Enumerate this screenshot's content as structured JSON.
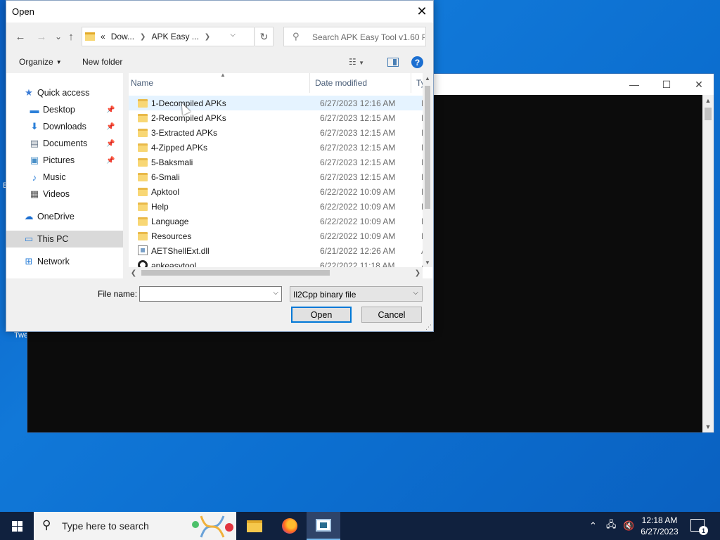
{
  "desktop": {
    "frag_letter": "E",
    "frag_text": "Twe"
  },
  "console": {
    "minimize": "—",
    "maximize": "☐",
    "close": "✕"
  },
  "dialog": {
    "title": "Open",
    "close": "✕",
    "nav": {
      "back": "←",
      "forward": "→",
      "recent": "⌄",
      "up": "↑",
      "breadcrumb": [
        "Dow...",
        "APK Easy ..."
      ],
      "crumb_prefix": "«",
      "refresh": "↻",
      "search_placeholder": "Search APK Easy Tool v1.60 P..."
    },
    "toolbar": {
      "organize": "Organize",
      "new_folder": "New folder",
      "help": "?"
    },
    "sidebar": [
      {
        "label": "Quick access",
        "icon": "star-icon",
        "glyph": "★",
        "color": "#3a7bd5"
      },
      {
        "label": "Desktop",
        "icon": "desktop-icon",
        "glyph": "▬",
        "color": "#2b7fd8",
        "pinned": true
      },
      {
        "label": "Downloads",
        "icon": "downloads-icon",
        "glyph": "⬇",
        "color": "#2b7fd8",
        "pinned": true
      },
      {
        "label": "Documents",
        "icon": "documents-icon",
        "glyph": "▤",
        "color": "#6b7b8c",
        "pinned": true
      },
      {
        "label": "Pictures",
        "icon": "pictures-icon",
        "glyph": "▣",
        "color": "#4a90c8",
        "pinned": true
      },
      {
        "label": "Music",
        "icon": "music-icon",
        "glyph": "♪",
        "color": "#2b7fd8"
      },
      {
        "label": "Videos",
        "icon": "videos-icon",
        "glyph": "▦",
        "color": "#555"
      },
      {
        "label": "OneDrive",
        "icon": "onedrive-icon",
        "glyph": "☁",
        "color": "#1c6fd1"
      },
      {
        "label": "This PC",
        "icon": "this-pc-icon",
        "glyph": "▭",
        "color": "#2b7fd8",
        "selected": true
      },
      {
        "label": "Network",
        "icon": "network-icon",
        "glyph": "⊞",
        "color": "#2b7fd8"
      }
    ],
    "pin_glyph": "📌",
    "columns": {
      "name": "Name",
      "date": "Date modified",
      "type": "Ty"
    },
    "files": [
      {
        "name": "1-Decompiled APKs",
        "date": "6/27/2023 12:16 AM",
        "type": "Fi",
        "kind": "folder",
        "hover": true
      },
      {
        "name": "2-Recompiled APKs",
        "date": "6/27/2023 12:15 AM",
        "type": "Fi",
        "kind": "folder"
      },
      {
        "name": "3-Extracted APKs",
        "date": "6/27/2023 12:15 AM",
        "type": "Fi",
        "kind": "folder"
      },
      {
        "name": "4-Zipped APKs",
        "date": "6/27/2023 12:15 AM",
        "type": "Fi",
        "kind": "folder"
      },
      {
        "name": "5-Baksmali",
        "date": "6/27/2023 12:15 AM",
        "type": "Fi",
        "kind": "folder"
      },
      {
        "name": "6-Smali",
        "date": "6/27/2023 12:15 AM",
        "type": "Fi",
        "kind": "folder"
      },
      {
        "name": "Apktool",
        "date": "6/22/2022 10:09 AM",
        "type": "Fi",
        "kind": "folder"
      },
      {
        "name": "Help",
        "date": "6/22/2022 10:09 AM",
        "type": "Fi",
        "kind": "folder"
      },
      {
        "name": "Language",
        "date": "6/22/2022 10:09 AM",
        "type": "Fi",
        "kind": "folder"
      },
      {
        "name": "Resources",
        "date": "6/22/2022 10:09 AM",
        "type": "Fi",
        "kind": "folder"
      },
      {
        "name": "AETShellExt.dll",
        "date": "6/21/2022 12:26 AM",
        "type": "Ap",
        "kind": "dll"
      },
      {
        "name": "apkeasytool",
        "date": "6/22/2022 11:18 AM",
        "type": "Ap",
        "kind": "app"
      }
    ],
    "file_name_label": "File name:",
    "file_name_value": "",
    "file_type": "Il2Cpp binary file",
    "open_button": "Open",
    "cancel_button": "Cancel"
  },
  "taskbar": {
    "search_placeholder": "Type here to search",
    "time": "12:18 AM",
    "date": "6/27/2023",
    "notifications": "1"
  }
}
